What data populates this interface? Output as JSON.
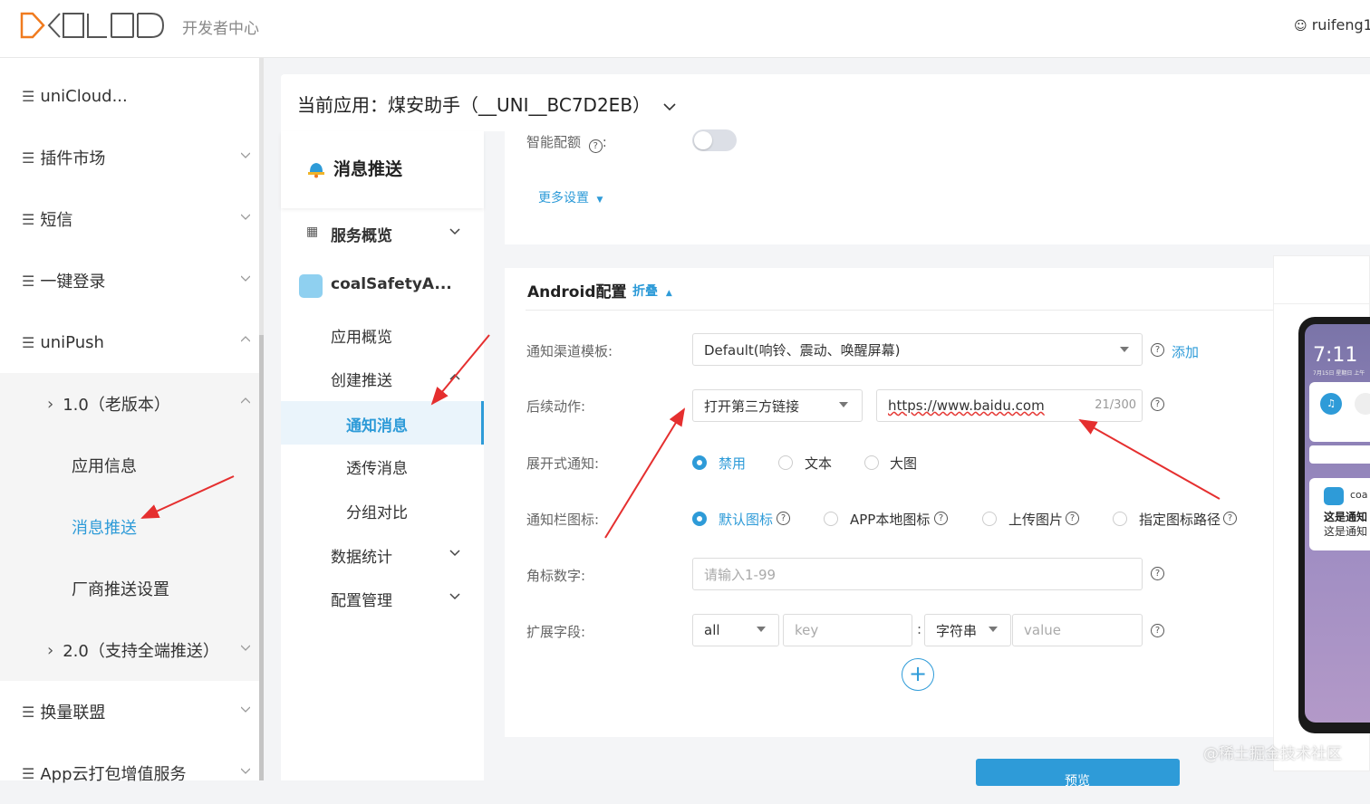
{
  "header": {
    "logo_text": "DCLOUD",
    "subtitle": "开发者中心",
    "user": "ruifeng1"
  },
  "sidebar": {
    "items": [
      {
        "label": "uniCloud..."
      },
      {
        "label": "插件市场"
      },
      {
        "label": "短信"
      },
      {
        "label": "一键登录"
      },
      {
        "label": "uniPush"
      },
      {
        "label": "1.0（老版本）"
      },
      {
        "label": "应用信息"
      },
      {
        "label": "消息推送"
      },
      {
        "label": "厂商推送设置"
      },
      {
        "label": "2.0（支持全端推送）"
      },
      {
        "label": "换量联盟"
      },
      {
        "label": "App云打包增值服务"
      }
    ]
  },
  "main": {
    "current_app": "当前应用：煤安助手（__UNI__BC7D2EB）"
  },
  "nav2": {
    "title": "消息推送",
    "items": [
      {
        "label": "服务概览"
      },
      {
        "label": "coalSafetyA..."
      },
      {
        "label": "应用概览"
      },
      {
        "label": "创建推送"
      },
      {
        "label": "通知消息"
      },
      {
        "label": "透传消息"
      },
      {
        "label": "分组对比"
      },
      {
        "label": "数据统计"
      },
      {
        "label": "配置管理"
      }
    ]
  },
  "form": {
    "smart_config_label": "智能配额",
    "more_settings": "更多设置",
    "android_title": "Android配置",
    "collapse": "折叠",
    "channel_label": "通知渠道模板:",
    "channel_value": "Default(响铃、震动、唤醒屏幕)",
    "add_link": "添加",
    "action_label": "后续动作:",
    "action_value": "打开第三方链接",
    "url_value": "https://www.baidu.com",
    "url_count": "21/300",
    "expand_label": "展开式通知:",
    "expand_options": [
      "禁用",
      "文本",
      "大图"
    ],
    "icon_label": "通知栏图标:",
    "icon_options": [
      "默认图标",
      "APP本地图标",
      "上传图片",
      "指定图标路径"
    ],
    "badge_label": "角标数字:",
    "badge_placeholder": "请输入1-99",
    "ext_label": "扩展字段:",
    "ext_scope": "all",
    "ext_key_placeholder": "key",
    "ext_separator": ":",
    "ext_type": "字符串",
    "ext_value_placeholder": "value",
    "preview_button": "预览"
  },
  "phone": {
    "time": "7:11",
    "date": "7月15日 星期日 上午",
    "notif_app": "coa",
    "notif_title": "这是通知",
    "notif_body": "这是通知"
  },
  "watermark": "@稀土掘金技术社区",
  "colors": {
    "accent": "#2e9bd8",
    "annotation": "#e52f2f"
  }
}
